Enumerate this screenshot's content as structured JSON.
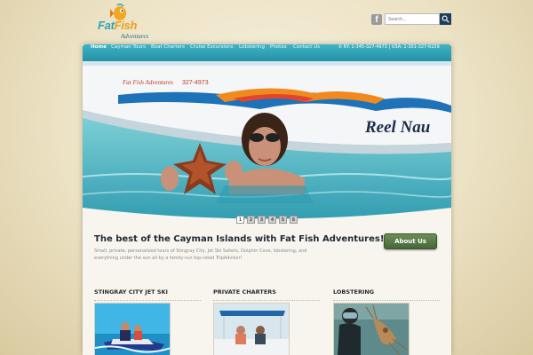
{
  "brand": {
    "logo_word1": "Fat",
    "logo_word2": "Fish",
    "logo_sub": "Adventures",
    "accent_color": "#2ca5b8",
    "logo_color": "#e8a01c"
  },
  "header": {
    "facebook_icon": "facebook-icon",
    "search": {
      "placeholder": "Search..."
    }
  },
  "nav": {
    "items": [
      {
        "label": "Home"
      },
      {
        "label": "Cayman Tours"
      },
      {
        "label": "Boat Charters"
      },
      {
        "label": "Cruise Excursions"
      },
      {
        "label": "Lobstering"
      },
      {
        "label": "Photos"
      },
      {
        "label": "Contact Us"
      }
    ],
    "phone": "KY: 1-345-327-4973 | USA: 1-301-327-6159"
  },
  "slider": {
    "boat_logo": "Fat Fish Adventures",
    "boat_phone": "327-4973",
    "boat_name": "Reel Nau",
    "dots": [
      "1",
      "2",
      "3",
      "4",
      "5",
      "6"
    ],
    "active_dot": "1"
  },
  "intro": {
    "headline": "The best of the Cayman Islands with Fat Fish Adventures!",
    "tagline": "Small, private, personalized tours of Stingray City, Jet Ski Safaris, Dolphin Cove, lobstering, and everything under the sun all by a family-run top-rated TripAdvisor!",
    "about_button": "About Us"
  },
  "columns": [
    {
      "title": "STINGRAY CITY JET SKI"
    },
    {
      "title": "PRIVATE CHARTERS"
    },
    {
      "title": "LOBSTERING"
    }
  ]
}
